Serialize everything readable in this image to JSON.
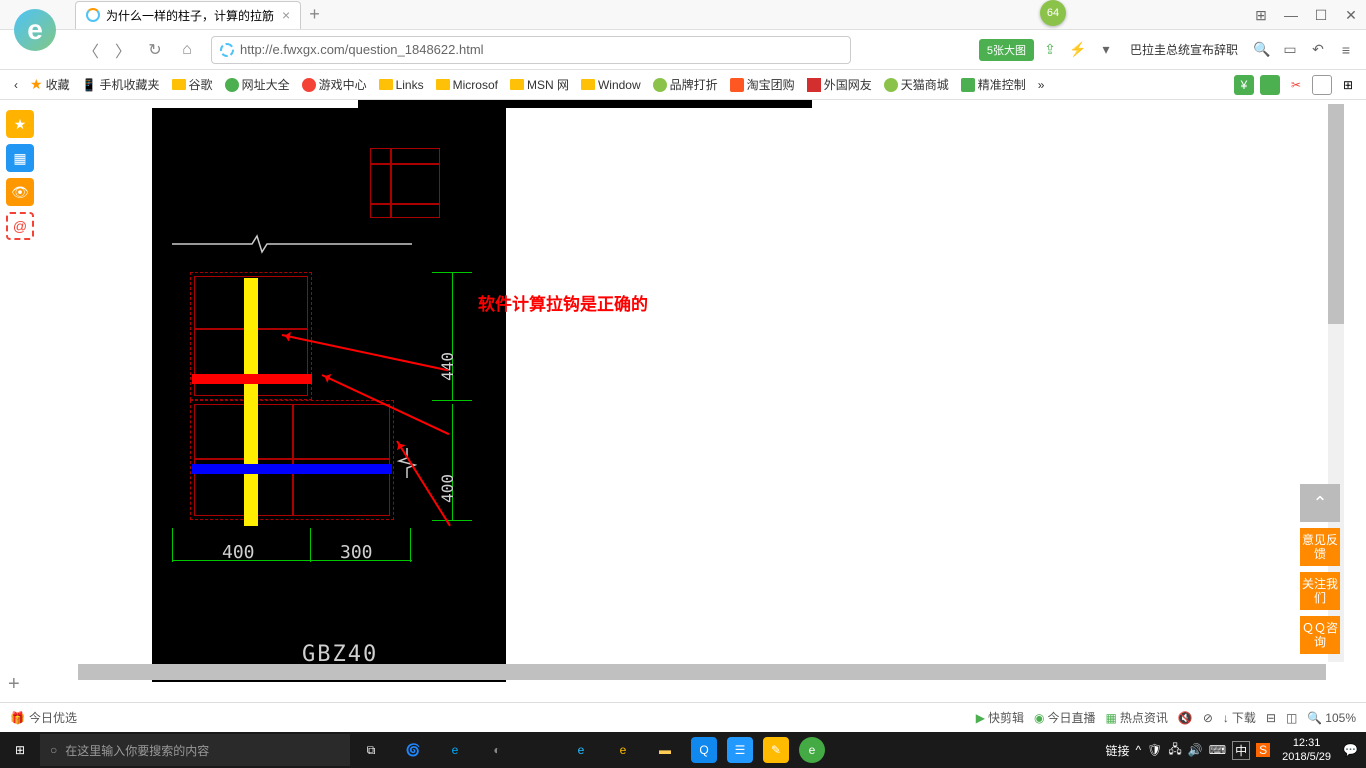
{
  "tab": {
    "title": "为什么一样的柱子，计算的拉筋"
  },
  "url": "http://e.fwxgx.com/question_1848622.html",
  "badge": "64",
  "greenBtn": "5张大图",
  "headline": "巴拉圭总统宣布辞职",
  "bookmarks": {
    "fav": "收藏",
    "mobile": "手机收藏夹",
    "google": "谷歌",
    "sites": "网址大全",
    "games": "游戏中心",
    "links": "Links",
    "microsof": "Microsof",
    "msn": "MSN 网",
    "window": "Window",
    "brand": "品牌打折",
    "taobao": "淘宝团购",
    "foreign": "外国网友",
    "tmall": "天猫商城",
    "ctrl": "精准控制"
  },
  "cad": {
    "annotation": "软件计算拉钩是正确的",
    "dim400a": "400",
    "dim300": "300",
    "dim440": "440",
    "dim400b": "400",
    "label": "GBZ40"
  },
  "float": {
    "feedback": "意见反馈",
    "follow": "关注我们",
    "qq": "ＱＱ咨询"
  },
  "status": {
    "today": "今日优选",
    "clip": "快剪辑",
    "live": "今日直播",
    "hot": "热点资讯",
    "download": "下载",
    "zoom": "105%"
  },
  "taskbar": {
    "search": "在这里输入你要搜索的内容",
    "link": "链接",
    "time": "12:31",
    "date": "2018/5/29"
  }
}
